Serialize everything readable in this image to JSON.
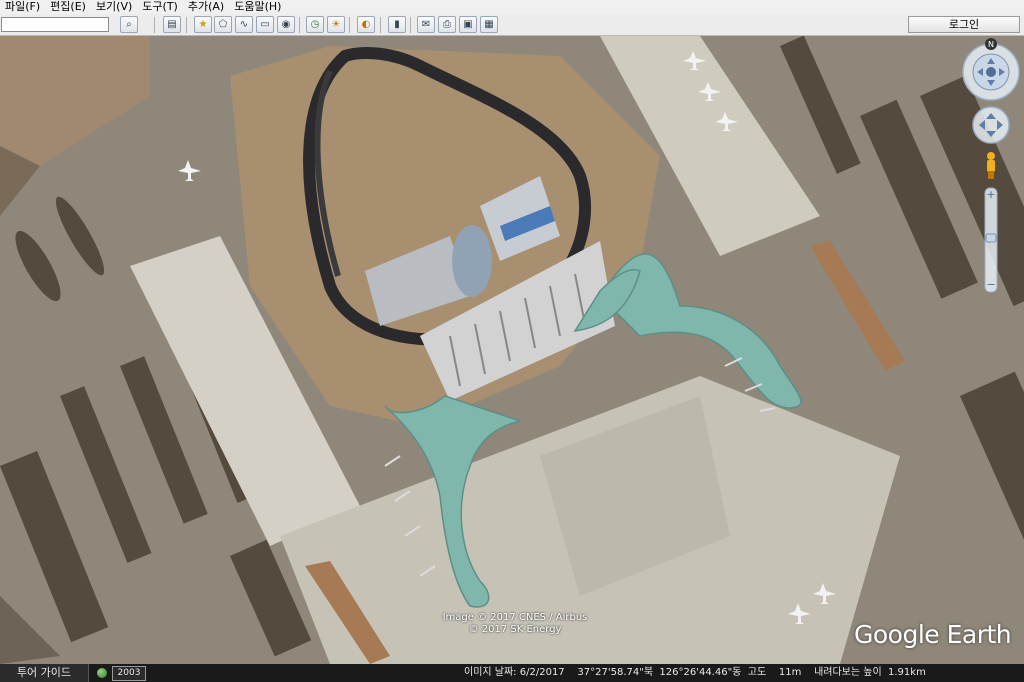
{
  "menu": [
    "파일(F)",
    "편집(E)",
    "보기(V)",
    "도구(T)",
    "추가(A)",
    "도움말(H)"
  ],
  "search": {
    "placeholder": ""
  },
  "toolbar": {
    "buttons": [
      "search-icon",
      "sidebar-icon",
      "placemark-icon",
      "polygon-icon",
      "path-icon",
      "overlay-icon",
      "tour-icon",
      "historical-imagery-icon",
      "sun-icon",
      "planets-icon",
      "ruler-icon",
      "email-icon",
      "print-icon",
      "save-image-icon",
      "view-in-maps-icon"
    ],
    "login_label": "로그인"
  },
  "navigation": {
    "north_label": "N",
    "zoom_in": "+",
    "zoom_out": "−"
  },
  "attribution": {
    "line1": "Image © 2017 CNES / Airbus",
    "line2": "© 2017 SK Energy"
  },
  "logo": {
    "text": "Google Earth"
  },
  "status": {
    "tour_guide": "투어 가이드",
    "year": "2003",
    "imagery_date_label": "이미지 날짜:",
    "imagery_date": "6/2/2017",
    "lat": "37°27'58.74\"북",
    "lon": "126°26'44.46\"동",
    "elev_label": "고도",
    "elev": "11m",
    "eye_alt_label": "내려다보는 높이",
    "eye_alt": "1.91km"
  },
  "colors": {
    "terminal_roof": "#7fb7ad",
    "apron": "#c9c4b8",
    "ground": "#8a8478"
  }
}
